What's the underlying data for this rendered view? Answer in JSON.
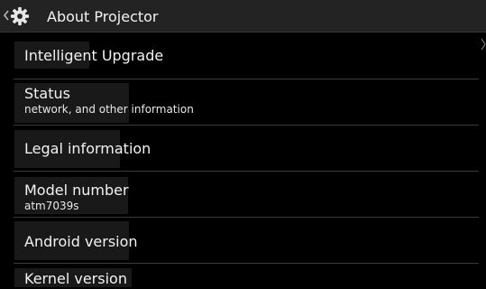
{
  "header": {
    "title": "About Projector",
    "back_icon": "chevron-left-icon",
    "app_icon": "gear-icon"
  },
  "items": [
    {
      "label": "Intelligent Upgrade",
      "sublabel": ""
    },
    {
      "label": "Status",
      "sublabel": "network, and other information"
    },
    {
      "label": "Legal information",
      "sublabel": ""
    },
    {
      "label": "Model number",
      "sublabel": "atm7039s"
    },
    {
      "label": "Android version",
      "sublabel": ""
    },
    {
      "label": "Kernel version",
      "sublabel": ""
    }
  ],
  "colors": {
    "background": "#000000",
    "action_bar": "#232323",
    "text": "#f2f2f2",
    "separator": "#3a3a3a"
  }
}
